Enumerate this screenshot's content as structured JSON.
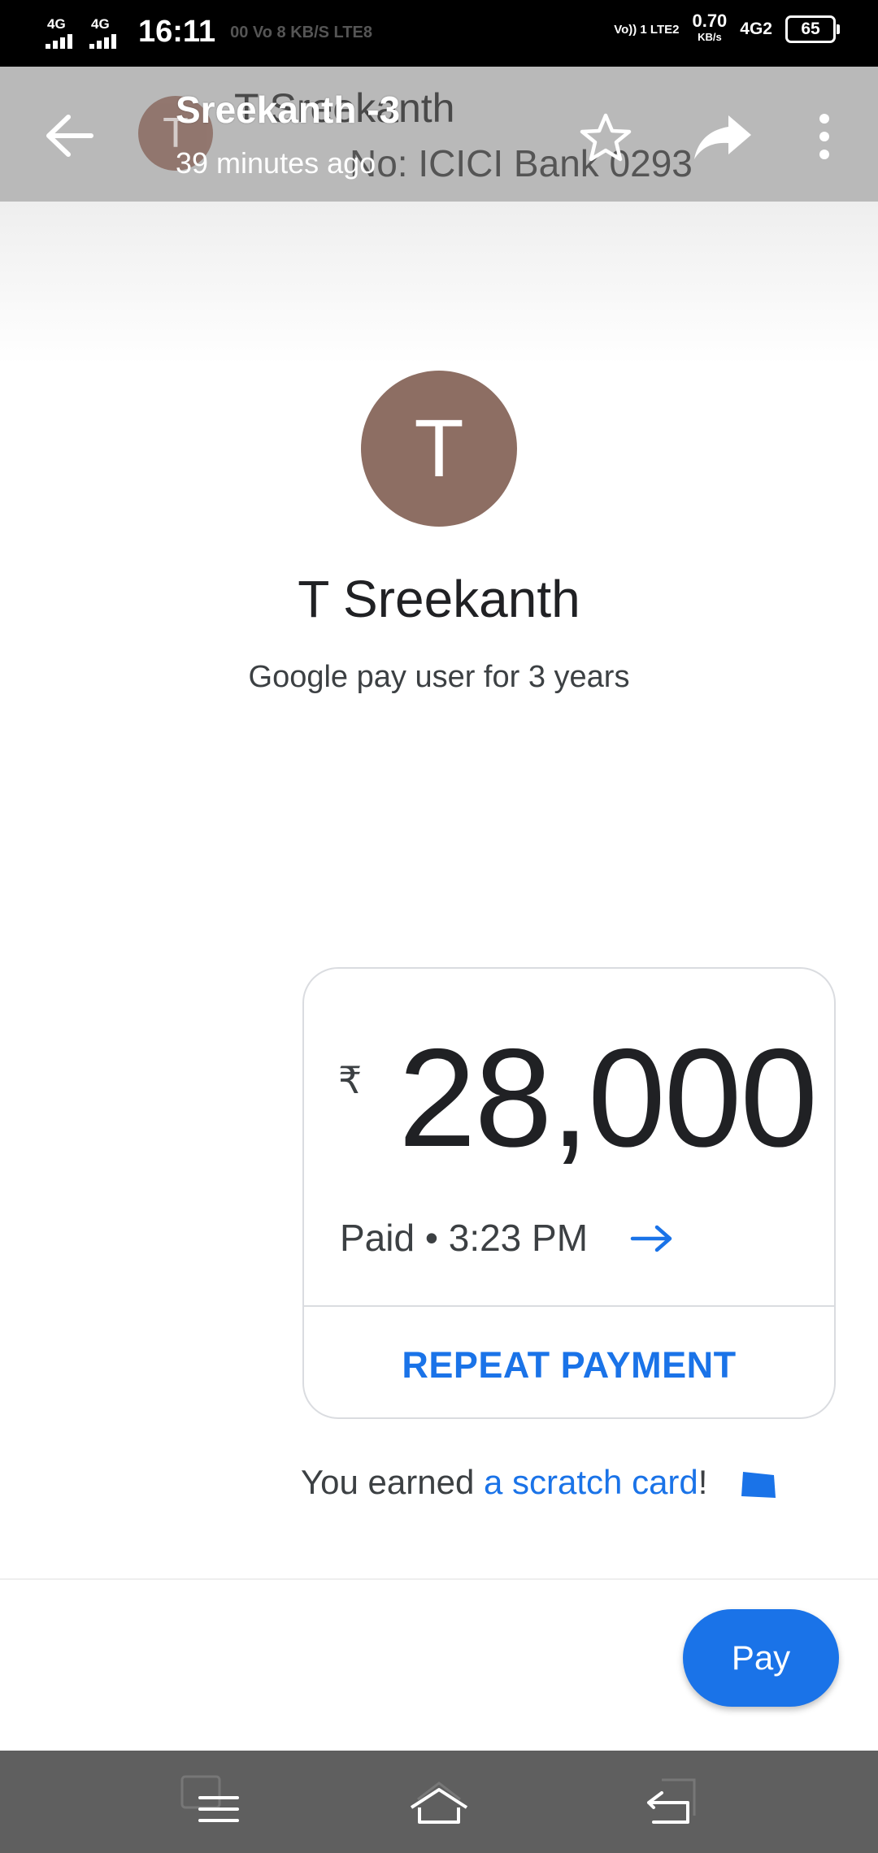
{
  "status_bar": {
    "sim1_type": "4G",
    "sim2_type": "4G",
    "time": "16:11",
    "ghost_text": "00 Vo 8 KB/S LTE8",
    "volte_label": "Vo)) 1 LTE2",
    "speed_value": "0.70",
    "speed_unit": "KB/s",
    "net_type": "4G2",
    "battery": "65"
  },
  "app_bar": {
    "title": "Sreekanth -3",
    "subtitle": "39 minutes ago",
    "background_name": "T Sreekanth",
    "background_account": "No: ICICI Bank 0293",
    "background_avatar_letter": "T",
    "icons": [
      "back-arrow-icon",
      "star-icon",
      "share-icon",
      "more-vert-icon"
    ]
  },
  "contact": {
    "avatar_letter": "T",
    "avatar_color": "#8d6e63",
    "name": "T Sreekanth",
    "since": "Google pay user for 3 years"
  },
  "payment": {
    "currency_symbol": "₹",
    "amount": "28,000",
    "status": "Paid • 3:23 PM",
    "repeat_label": "REPEAT PAYMENT"
  },
  "reward": {
    "prefix": "You earned ",
    "link": "a scratch card",
    "suffix": "!"
  },
  "pay_button": "Pay",
  "colors": {
    "accent": "#1a73e8",
    "appbar": "#b9b9b9",
    "navbar": "#5f5f5f"
  }
}
